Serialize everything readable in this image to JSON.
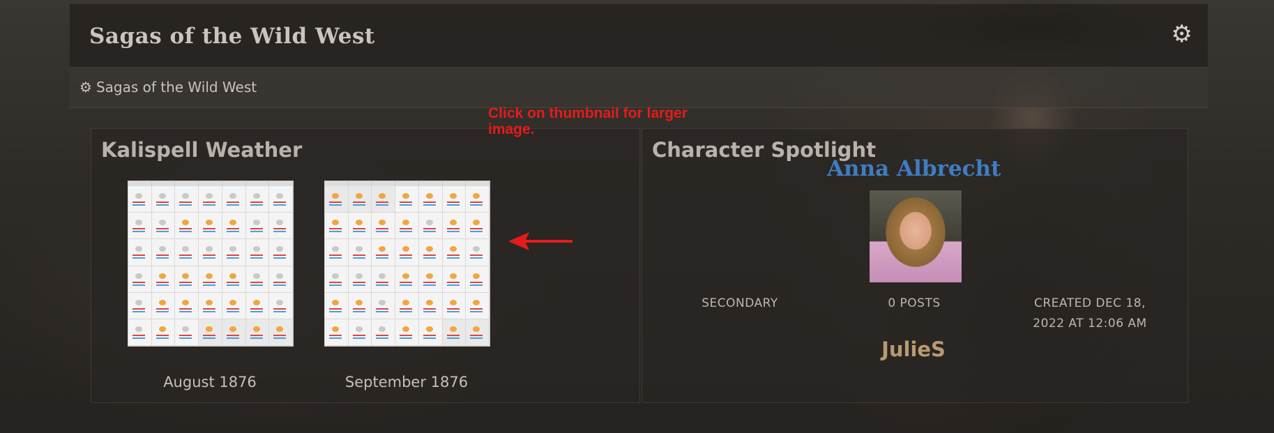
{
  "header": {
    "site_title": "Sagas of the Wild West",
    "gear_icon": "gear-icon"
  },
  "breadcrumb": {
    "icon": "gear-icon",
    "label": "Sagas of the Wild West"
  },
  "weather": {
    "title": "Kalispell Weather",
    "thumbnails": [
      {
        "caption": "August 1876"
      },
      {
        "caption": "September 1876"
      }
    ],
    "hint": "Click on thumbnail for larger image.",
    "hint_color": "#e51b1b"
  },
  "spotlight": {
    "title": "Character Spotlight",
    "character_name": "Anna Albrecht",
    "name_color": "#3f7dc3",
    "role": "SECONDARY",
    "posts": "0 POSTS",
    "created": "CREATED DEC 18, 2022 AT 12:06 AM",
    "player": "JulieS",
    "player_color": "#b89a70"
  }
}
